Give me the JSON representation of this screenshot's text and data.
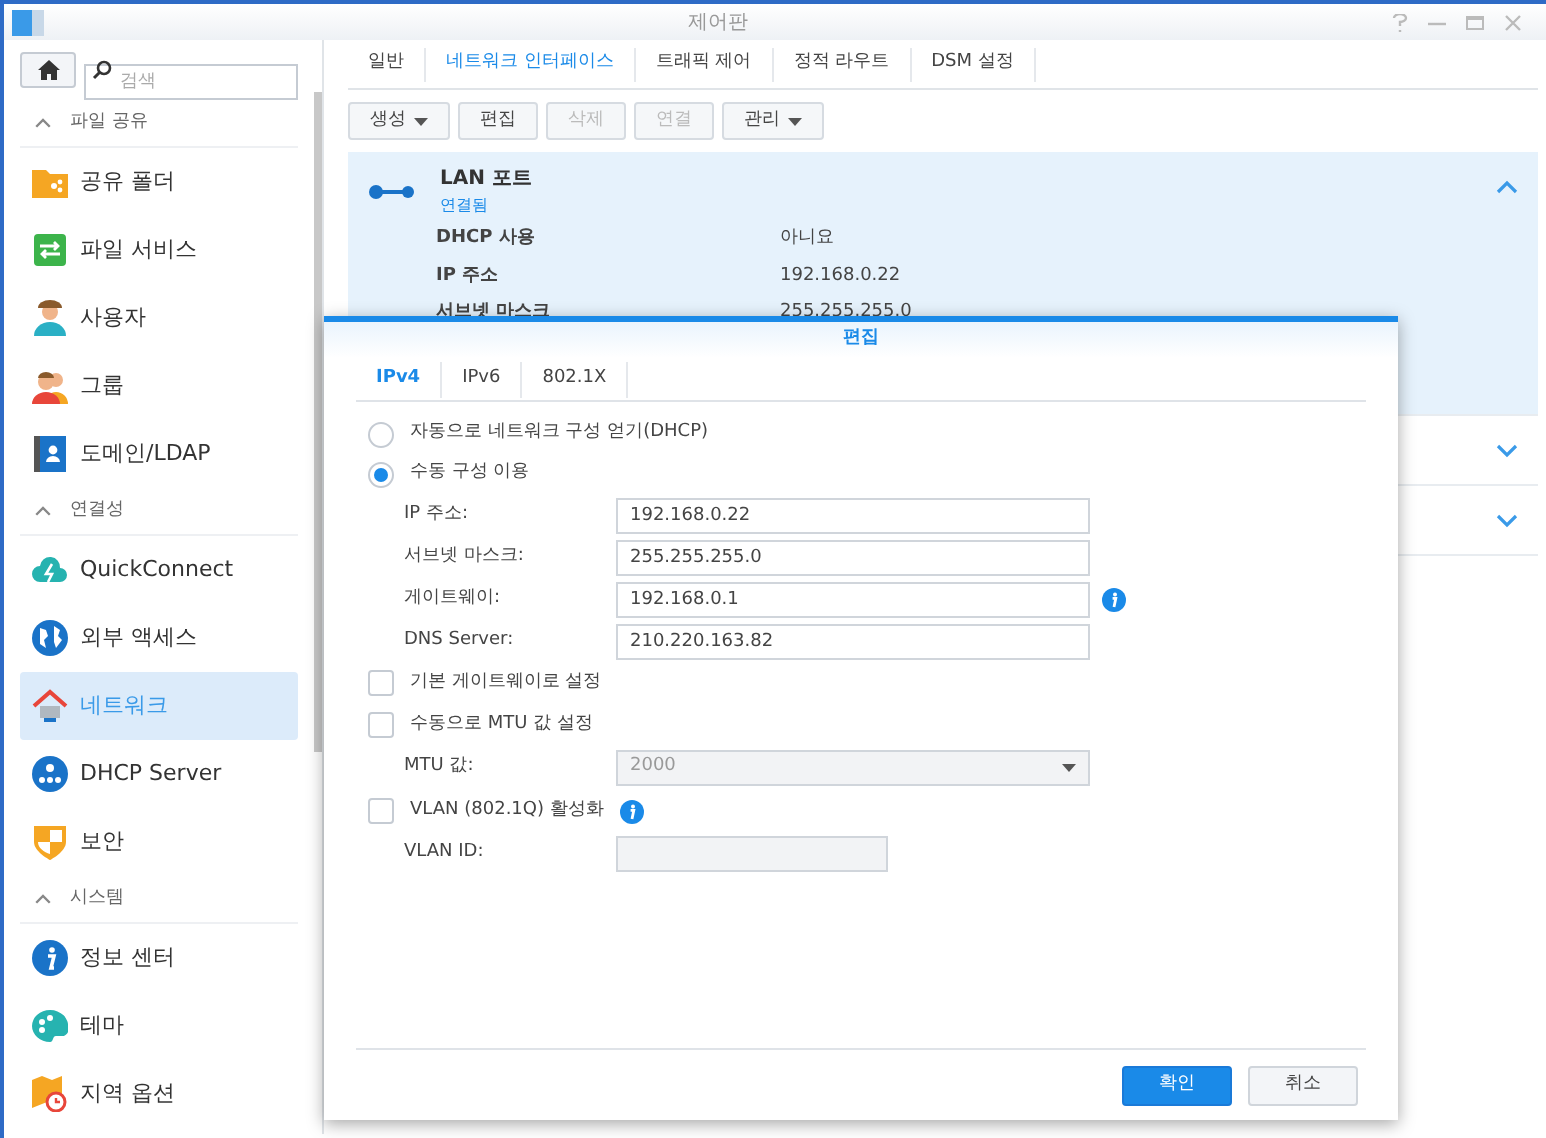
{
  "window": {
    "title": "제어판"
  },
  "search": {
    "placeholder": "검색"
  },
  "sidebar": {
    "items": [
      {
        "kind": "section",
        "label": "파일 공유",
        "expanded": true
      },
      {
        "kind": "item",
        "label": "공유 폴더",
        "selected": false
      },
      {
        "kind": "item",
        "label": "파일 서비스",
        "selected": false
      },
      {
        "kind": "item",
        "label": "사용자",
        "selected": false
      },
      {
        "kind": "item",
        "label": "그룹",
        "selected": false
      },
      {
        "kind": "item",
        "label": "도메인/LDAP",
        "selected": false
      },
      {
        "kind": "section",
        "label": "연결성",
        "expanded": true
      },
      {
        "kind": "item",
        "label": "QuickConnect",
        "selected": false
      },
      {
        "kind": "item",
        "label": "외부 액세스",
        "selected": false
      },
      {
        "kind": "item",
        "label": "네트워크",
        "selected": true
      },
      {
        "kind": "item",
        "label": "DHCP Server",
        "selected": false
      },
      {
        "kind": "item",
        "label": "보안",
        "selected": false
      },
      {
        "kind": "section",
        "label": "시스템",
        "expanded": true
      },
      {
        "kind": "item",
        "label": "정보 센터",
        "selected": false
      },
      {
        "kind": "item",
        "label": "테마",
        "selected": false
      },
      {
        "kind": "item",
        "label": "지역 옵션",
        "selected": false
      }
    ]
  },
  "tabs": [
    {
      "label": "일반",
      "selected": false
    },
    {
      "label": "네트워크 인터페이스",
      "selected": true
    },
    {
      "label": "트래픽 제어",
      "selected": false
    },
    {
      "label": "정적 라우트",
      "selected": false
    },
    {
      "label": "DSM 설정",
      "selected": false
    }
  ],
  "toolbar": [
    {
      "label": "생성",
      "dropdown": true,
      "disabled": false
    },
    {
      "label": "편집",
      "dropdown": false,
      "disabled": false
    },
    {
      "label": "삭제",
      "dropdown": false,
      "disabled": true
    },
    {
      "label": "연결",
      "dropdown": false,
      "disabled": true
    },
    {
      "label": "관리",
      "dropdown": true,
      "disabled": false
    }
  ],
  "interfaces": [
    {
      "name": "LAN 포트",
      "status": "연결됨",
      "expanded": true,
      "details": [
        {
          "label": "DHCP 사용",
          "value": "아니요"
        },
        {
          "label": "IP 주소",
          "value": "192.168.0.22"
        },
        {
          "label": "서브넷 마스크",
          "value": "255.255.255.0"
        }
      ]
    },
    {
      "expanded": false
    },
    {
      "expanded": false
    }
  ],
  "dialog": {
    "title": "편집",
    "tabs": [
      {
        "label": "IPv4",
        "selected": true
      },
      {
        "label": "IPv6",
        "selected": false
      },
      {
        "label": "802.1X",
        "selected": false
      }
    ],
    "radios": [
      {
        "label": "자동으로 네트워크 구성 얻기(DHCP)",
        "selected": false
      },
      {
        "label": "수동 구성 이용",
        "selected": true
      }
    ],
    "fields": [
      {
        "label": "IP 주소:",
        "value": "192.168.0.22",
        "info": false
      },
      {
        "label": "서브넷 마스크:",
        "value": "255.255.255.0",
        "info": false
      },
      {
        "label": "게이트웨이:",
        "value": "192.168.0.1",
        "info": true
      },
      {
        "label": "DNS Server:",
        "value": "210.220.163.82",
        "info": false
      }
    ],
    "default_gateway": {
      "label": "기본 게이트웨이로 설정",
      "checked": false
    },
    "manual_mtu": {
      "label": "수동으로 MTU 값 설정",
      "checked": false
    },
    "mtu": {
      "label": "MTU 값:",
      "value": "2000",
      "disabled": true
    },
    "vlan": {
      "label": "VLAN (802.1Q) 활성화",
      "checked": false
    },
    "vlan_id": {
      "label": "VLAN ID:",
      "disabled": true
    },
    "buttons": [
      {
        "label": "확인",
        "kind": "primary"
      },
      {
        "label": "취소",
        "kind": "secondary"
      }
    ]
  }
}
